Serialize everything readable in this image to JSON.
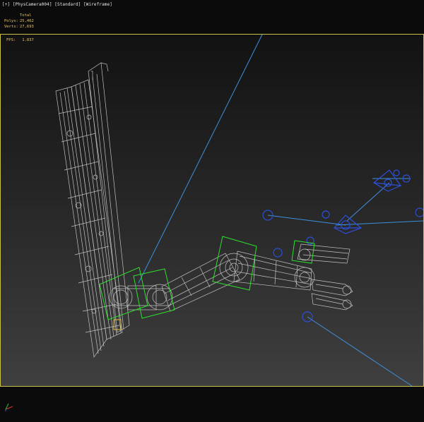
{
  "viewport": {
    "label": "[+] [PhysCamera004] [Standard] [Wireframe]"
  },
  "stats": {
    "header": "Total",
    "polys_label": "Polys:",
    "polys_value": "25,462",
    "verts_label": "Verts:",
    "verts_value": "27,693"
  },
  "fps": {
    "label": "FPS:",
    "value": "1.837"
  },
  "colors": {
    "viewport_border": "#c8c04a",
    "stats_text": "#e6c46a",
    "wireframe": "#d2d2d2",
    "helper_line": "#3f8fdf",
    "camera_icon": "#2b4fd8",
    "selection_box": "#2ee02e",
    "axis_x": "#e03030",
    "axis_y": "#30c030",
    "axis_z": "#3060e0"
  }
}
